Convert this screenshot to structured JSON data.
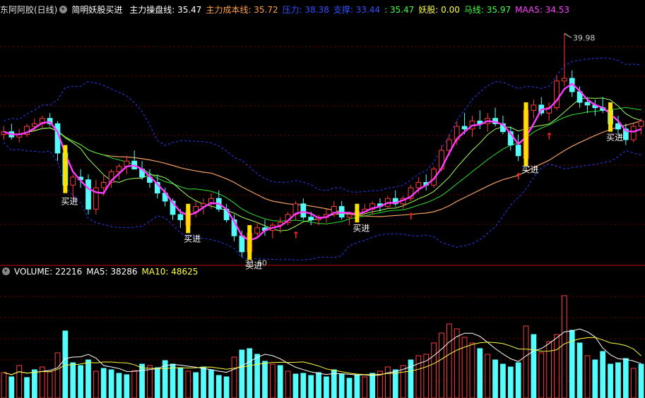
{
  "colors": {
    "background": "#000000",
    "grid": "#7a0000",
    "up": "#ff3b3b",
    "down": "#54fcfc",
    "signal": "#ffe000",
    "ma_pink": "#ff3cff",
    "ma_orange": "#f0a060",
    "ma_green": "#2ee02e",
    "ma_lime": "#a0ff60",
    "band": "#2a3cff",
    "vol_ma5": "#ffffff",
    "vol_ma10": "#ffff40",
    "arrow": "#ff2020"
  },
  "header": {
    "stock_name": "东阿阿胶(日线)",
    "indicator_name": "简明妖股买进",
    "items": [
      {
        "label": "主力操盘线: 35.47",
        "color": "#ffffff"
      },
      {
        "label": "主力成本线: 35.72",
        "color": "#ffa040"
      },
      {
        "label": "压力: 38.38",
        "color": "#3050ff"
      },
      {
        "label": "支撑: 33.44",
        "color": "#3050ff"
      },
      {
        "label": ": 35.47",
        "color": "#40ff40"
      },
      {
        "label": "妖股: 0.00",
        "color": "#ffff40"
      },
      {
        "label": "马线: 35.97",
        "color": "#40ff40"
      },
      {
        "label": "MAA5: 34.53",
        "color": "#ff40ff"
      }
    ]
  },
  "volume_header": {
    "items": [
      {
        "label": "VOLUME: 22216",
        "color": "#ffffff"
      },
      {
        "label": "MA5: 38286",
        "color": "#ffffff"
      },
      {
        "label": "MA10: 48625",
        "color": "#ffff40"
      }
    ]
  },
  "chart_data": {
    "type": "candlestick",
    "price_range": [
      31.4,
      40.6
    ],
    "volume_range": [
      0,
      170000
    ],
    "high_label": "39.98",
    "low_label": "31.60",
    "buy_label": "买进",
    "up_arrow_glyph": "↑",
    "buy_signals": [
      8,
      24,
      32,
      46,
      68,
      79
    ],
    "up_arrows": [
      38,
      53,
      67,
      71
    ],
    "candles": [
      [
        36.2,
        36.5,
        36.0,
        36.3
      ],
      [
        36.3,
        36.6,
        36.0,
        36.1
      ],
      [
        36.1,
        36.4,
        35.9,
        36.2
      ],
      [
        36.2,
        36.6,
        36.1,
        36.5
      ],
      [
        36.5,
        36.8,
        36.3,
        36.6
      ],
      [
        36.6,
        36.9,
        36.4,
        36.8
      ],
      [
        36.8,
        37.0,
        36.5,
        36.6
      ],
      [
        36.6,
        36.7,
        35.2,
        35.5
      ],
      [
        35.5,
        35.7,
        34.0,
        34.3
      ],
      [
        34.3,
        34.7,
        33.8,
        34.6
      ],
      [
        34.6,
        34.9,
        34.2,
        34.5
      ],
      [
        34.5,
        34.7,
        33.2,
        33.4
      ],
      [
        33.4,
        34.5,
        33.2,
        34.2
      ],
      [
        34.2,
        34.7,
        33.9,
        34.4
      ],
      [
        34.4,
        34.9,
        34.2,
        34.8
      ],
      [
        34.8,
        35.1,
        34.5,
        35.0
      ],
      [
        35.0,
        35.4,
        34.7,
        35.2
      ],
      [
        35.2,
        35.6,
        35.0,
        34.9
      ],
      [
        34.9,
        35.2,
        34.5,
        34.6
      ],
      [
        34.6,
        34.9,
        34.2,
        34.4
      ],
      [
        34.4,
        34.7,
        33.8,
        34.0
      ],
      [
        34.0,
        34.2,
        33.5,
        33.7
      ],
      [
        33.7,
        33.8,
        33.0,
        33.2
      ],
      [
        33.2,
        33.4,
        32.7,
        33.0
      ],
      [
        32.8,
        33.4,
        32.6,
        33.3
      ],
      [
        33.3,
        33.7,
        33.1,
        33.5
      ],
      [
        33.5,
        33.8,
        33.2,
        33.6
      ],
      [
        33.6,
        34.0,
        33.4,
        33.8
      ],
      [
        33.8,
        34.1,
        33.3,
        33.4
      ],
      [
        33.4,
        33.6,
        32.9,
        33.0
      ],
      [
        33.0,
        33.2,
        32.2,
        32.4
      ],
      [
        32.4,
        32.6,
        31.6,
        31.8
      ],
      [
        31.8,
        32.7,
        31.6,
        32.5
      ],
      [
        32.5,
        32.9,
        32.3,
        32.7
      ],
      [
        32.7,
        33.0,
        32.4,
        32.6
      ],
      [
        32.6,
        32.9,
        32.3,
        32.8
      ],
      [
        32.8,
        33.1,
        32.5,
        32.9
      ],
      [
        32.9,
        33.3,
        32.8,
        33.2
      ],
      [
        33.2,
        33.7,
        33.0,
        33.6
      ],
      [
        33.6,
        33.8,
        33.0,
        33.1
      ],
      [
        33.1,
        33.3,
        32.8,
        33.0
      ],
      [
        33.0,
        33.2,
        32.8,
        33.1
      ],
      [
        33.1,
        33.4,
        32.9,
        33.2
      ],
      [
        33.2,
        33.7,
        33.1,
        33.5
      ],
      [
        33.5,
        33.7,
        33.0,
        33.1
      ],
      [
        33.1,
        33.3,
        32.8,
        33.2
      ],
      [
        33.2,
        33.5,
        33.0,
        33.3
      ],
      [
        33.3,
        33.6,
        33.1,
        33.4
      ],
      [
        33.4,
        33.7,
        33.2,
        33.6
      ],
      [
        33.6,
        33.8,
        33.3,
        33.5
      ],
      [
        33.5,
        33.9,
        33.4,
        33.8
      ],
      [
        33.8,
        34.1,
        33.5,
        33.6
      ],
      [
        33.6,
        33.9,
        33.4,
        33.8
      ],
      [
        33.8,
        34.3,
        33.7,
        34.2
      ],
      [
        34.2,
        34.6,
        34.0,
        34.4
      ],
      [
        34.4,
        34.7,
        34.1,
        34.3
      ],
      [
        34.3,
        35.0,
        34.2,
        34.9
      ],
      [
        34.9,
        35.8,
        34.8,
        35.6
      ],
      [
        35.6,
        36.2,
        35.4,
        36.0
      ],
      [
        36.0,
        36.7,
        35.8,
        36.5
      ],
      [
        36.5,
        37.0,
        36.2,
        36.4
      ],
      [
        36.4,
        36.9,
        36.1,
        36.7
      ],
      [
        36.7,
        37.1,
        36.4,
        36.6
      ],
      [
        36.6,
        37.0,
        36.3,
        36.8
      ],
      [
        36.8,
        37.2,
        36.5,
        36.6
      ],
      [
        36.6,
        36.9,
        36.2,
        36.3
      ],
      [
        36.3,
        36.5,
        35.6,
        35.8
      ],
      [
        35.8,
        36.2,
        35.2,
        35.4
      ],
      [
        35.3,
        37.3,
        35.2,
        37.1
      ],
      [
        37.1,
        37.5,
        36.8,
        37.3
      ],
      [
        37.3,
        37.6,
        36.9,
        37.0
      ],
      [
        37.0,
        37.4,
        36.7,
        37.2
      ],
      [
        37.2,
        38.4,
        37.1,
        38.2
      ],
      [
        38.2,
        39.98,
        38.0,
        38.3
      ],
      [
        38.3,
        38.6,
        37.6,
        37.8
      ],
      [
        37.8,
        38.0,
        37.2,
        37.4
      ],
      [
        37.4,
        37.6,
        37.0,
        37.3
      ],
      [
        37.3,
        37.5,
        36.9,
        37.2
      ],
      [
        37.2,
        37.6,
        37.0,
        37.1
      ],
      [
        37.1,
        37.4,
        36.4,
        36.6
      ],
      [
        36.6,
        36.9,
        36.2,
        36.4
      ],
      [
        36.4,
        36.6,
        35.8,
        36.0
      ],
      [
        36.0,
        36.6,
        35.9,
        36.5
      ],
      [
        36.5,
        36.8,
        36.2,
        36.7
      ]
    ],
    "volumes": [
      [
        36000,
        0
      ],
      [
        30000,
        1
      ],
      [
        46000,
        0
      ],
      [
        29000,
        1
      ],
      [
        40000,
        1
      ],
      [
        44000,
        0
      ],
      [
        37000,
        0
      ],
      [
        64000,
        0
      ],
      [
        95000,
        1
      ],
      [
        50000,
        1
      ],
      [
        46000,
        1
      ],
      [
        54000,
        1
      ],
      [
        38000,
        0
      ],
      [
        42000,
        1
      ],
      [
        40000,
        1
      ],
      [
        35000,
        1
      ],
      [
        33000,
        1
      ],
      [
        39000,
        0
      ],
      [
        48000,
        1
      ],
      [
        46000,
        0
      ],
      [
        43000,
        1
      ],
      [
        53000,
        1
      ],
      [
        48000,
        1
      ],
      [
        43000,
        1
      ],
      [
        38000,
        0
      ],
      [
        36000,
        1
      ],
      [
        44000,
        1
      ],
      [
        40000,
        1
      ],
      [
        32000,
        1
      ],
      [
        30000,
        1
      ],
      [
        58000,
        0
      ],
      [
        68000,
        1
      ],
      [
        70000,
        1
      ],
      [
        62000,
        1
      ],
      [
        52000,
        1
      ],
      [
        48000,
        0
      ],
      [
        46000,
        1
      ],
      [
        38000,
        0
      ],
      [
        34000,
        1
      ],
      [
        35000,
        1
      ],
      [
        32000,
        1
      ],
      [
        36000,
        1
      ],
      [
        30000,
        1
      ],
      [
        40000,
        1
      ],
      [
        34000,
        1
      ],
      [
        28000,
        1
      ],
      [
        32000,
        1
      ],
      [
        30000,
        0
      ],
      [
        35000,
        1
      ],
      [
        38000,
        0
      ],
      [
        44000,
        0
      ],
      [
        40000,
        1
      ],
      [
        46000,
        0
      ],
      [
        54000,
        1
      ],
      [
        60000,
        0
      ],
      [
        62000,
        0
      ],
      [
        78000,
        0
      ],
      [
        92000,
        0
      ],
      [
        105000,
        0
      ],
      [
        98000,
        0
      ],
      [
        86000,
        0
      ],
      [
        78000,
        0
      ],
      [
        70000,
        1
      ],
      [
        62000,
        0
      ],
      [
        54000,
        1
      ],
      [
        48000,
        1
      ],
      [
        44000,
        1
      ],
      [
        50000,
        1
      ],
      [
        102000,
        0
      ],
      [
        90000,
        1
      ],
      [
        64000,
        0
      ],
      [
        80000,
        0
      ],
      [
        90000,
        0
      ],
      [
        145000,
        0
      ],
      [
        96000,
        1
      ],
      [
        78000,
        1
      ],
      [
        60000,
        0
      ],
      [
        54000,
        1
      ],
      [
        66000,
        1
      ],
      [
        48000,
        1
      ],
      [
        50000,
        1
      ],
      [
        56000,
        1
      ],
      [
        42000,
        0
      ],
      [
        48000,
        1
      ]
    ]
  }
}
